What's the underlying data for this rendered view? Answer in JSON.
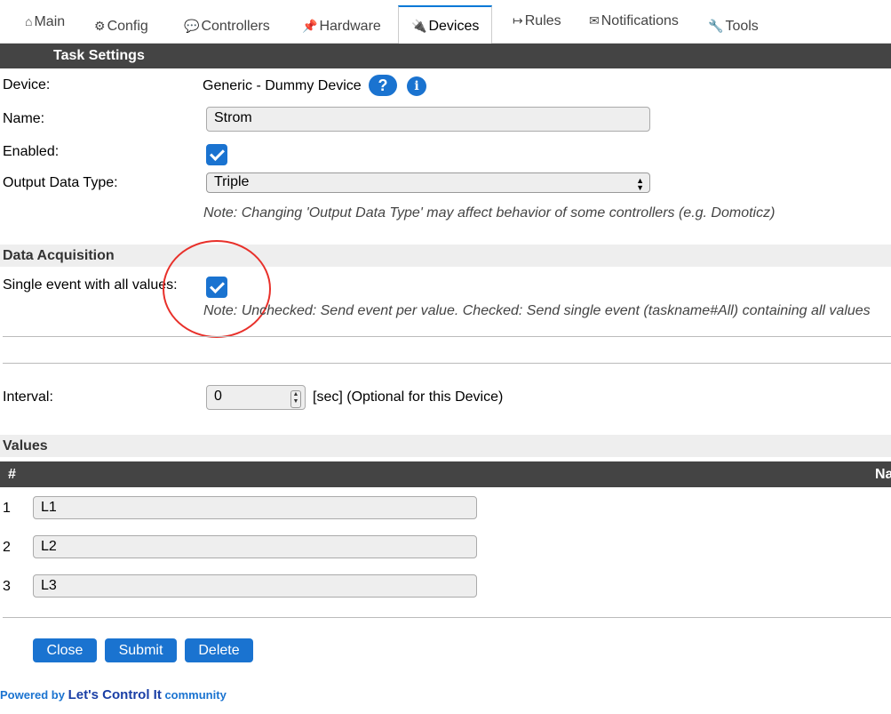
{
  "tabs": [
    {
      "icon": "⌂",
      "label": "Main"
    },
    {
      "icon": "⚙",
      "label": "Config"
    },
    {
      "icon": "💬",
      "label": "Controllers"
    },
    {
      "icon": "📌",
      "label": "Hardware"
    },
    {
      "icon": "🔌",
      "label": "Devices"
    },
    {
      "icon": "↦",
      "label": "Rules"
    },
    {
      "icon": "✉",
      "label": "Notifications"
    },
    {
      "icon": "🔧",
      "label": "Tools"
    }
  ],
  "active_tab": "Devices",
  "task_settings": {
    "header": "Task Settings",
    "device_label": "Device:",
    "device_value": "Generic - Dummy Device",
    "help_icon": "?",
    "info_icon": "i",
    "name_label": "Name:",
    "name_value": "Strom",
    "enabled_label": "Enabled:",
    "enabled": true,
    "output_label": "Output Data Type:",
    "output_value": "Triple",
    "output_note": "Note: Changing 'Output Data Type' may affect behavior of some controllers (e.g. Domoticz)"
  },
  "data_acquisition": {
    "header": "Data Acquisition",
    "single_event_label": "Single event with all values:",
    "single_event": true,
    "single_event_note": "Note: Unchecked: Send event per value. Checked: Send single event (taskname#All) containing all values",
    "interval_label": "Interval:",
    "interval_value": "0",
    "interval_suffix": "[sec] (Optional for this Device)"
  },
  "values": {
    "header": "Values",
    "col_num": "#",
    "col_name": "Na",
    "rows": [
      {
        "num": "1",
        "name": "L1"
      },
      {
        "num": "2",
        "name": "L2"
      },
      {
        "num": "3",
        "name": "L3"
      }
    ]
  },
  "buttons": {
    "close": "Close",
    "submit": "Submit",
    "delete": "Delete"
  },
  "footer": {
    "powered": "Powered by",
    "brand": "Let's Control It",
    "community": "community"
  },
  "colors": {
    "accent": "#1a73d0",
    "header_dark": "#444444",
    "annotation": "#e8302a"
  }
}
